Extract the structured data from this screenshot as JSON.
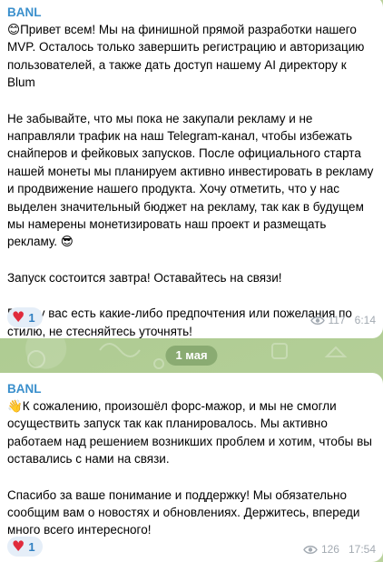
{
  "theme": {
    "sender_color": "#3a8fcc",
    "reaction_bg": "#e5eef8",
    "heart_color": "#e02b3c",
    "meta_color": "#a3aab2",
    "wallpaper": "#b7cf9c"
  },
  "messages": [
    {
      "sender": "BANL",
      "paragraphs": [
        "😊Привет всем! Мы на финишной прямой разработки нашего MVP. Осталось только завершить регистрацию и авторизацию пользователей, а также дать доступ нашему AI директору к Blum",
        "Не забывайте, что мы пока не закупали рекламу и не направляли трафик на наш Telegram-канал, чтобы избежать снайперов и фейковых запусков. После официального старта нашей монеты мы планируем активно инвестировать в рекламу и продвижение нашего продукта. Хочу отметить, что у нас выделен значительный бюджет на рекламу, так как в будущем мы намерены монетизировать наш проект и размещать рекламу. 😎",
        "Запуск состоится завтра! Оставайтесь на связи!",
        "Если у вас есть какие-либо предпочтения или пожелания по стилю, не стесняйтесь уточнять!"
      ],
      "reaction": {
        "emoji": "♥",
        "count": "1"
      },
      "views": "117",
      "time": "6:14"
    },
    {
      "sender": "BANL",
      "paragraphs": [
        "👋К сожалению, произошёл форс-мажор, и мы не смогли осуществить запуск так как планировалось. Мы активно работаем над решением возникших проблем и хотим, чтобы вы оставались с нами на связи.",
        "Спасибо за ваше понимание и поддержку! Мы обязательно сообщим вам о новостях и обновлениях. Держитесь, впереди много всего интересного!"
      ],
      "reaction": {
        "emoji": "♥",
        "count": "1"
      },
      "views": "126",
      "time": "17:54"
    }
  ],
  "date_separator": "1 мая"
}
